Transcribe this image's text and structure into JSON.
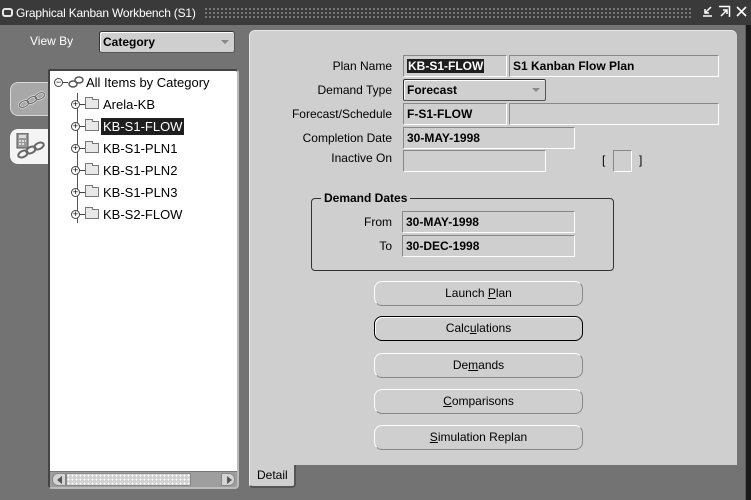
{
  "window": {
    "title": "Graphical Kanban Workbench (S1)",
    "controls": [
      "minimize-icon",
      "maximize-icon",
      "close-icon"
    ]
  },
  "view_by": {
    "label": "View By",
    "value": "Category"
  },
  "side_tabs": [
    {
      "name": "kanban-chain-icon",
      "active": false
    },
    {
      "name": "calculator-chain-icon",
      "active": true
    }
  ],
  "tree": {
    "root": "All Items by Category",
    "items": [
      {
        "label": "Arela-KB",
        "selected": false
      },
      {
        "label": "KB-S1-FLOW",
        "selected": true
      },
      {
        "label": "KB-S1-PLN1",
        "selected": false
      },
      {
        "label": "KB-S1-PLN2",
        "selected": false
      },
      {
        "label": "KB-S1-PLN3",
        "selected": false
      },
      {
        "label": "KB-S2-FLOW",
        "selected": false
      }
    ]
  },
  "detail": {
    "plan_name_label": "Plan Name",
    "plan_name": "KB-S1-FLOW",
    "plan_description": "S1 Kanban Flow Plan",
    "demand_type_label": "Demand Type",
    "demand_type": "Forecast",
    "forecast_schedule_label": "Forecast/Schedule",
    "forecast_schedule": "F-S1-FLOW",
    "forecast_schedule_desc": "",
    "completion_date_label": "Completion Date",
    "completion_date": "30-MAY-1998",
    "inactive_on_label": "Inactive On",
    "inactive_on": "",
    "bracket_open": "[",
    "bracket_close": "]",
    "demand_dates": {
      "title": "Demand Dates",
      "from_label": "From",
      "from": "30-MAY-1998",
      "to_label": "To",
      "to": "30-DEC-1998"
    },
    "buttons": [
      {
        "pre": "Launch ",
        "u": "P",
        "post": "lan"
      },
      {
        "pre": "Calc",
        "u": "u",
        "post": "lations"
      },
      {
        "pre": "De",
        "u": "m",
        "post": "ands"
      },
      {
        "pre": "",
        "u": "C",
        "post": "omparisons"
      },
      {
        "pre": "",
        "u": "S",
        "post": "imulation Replan"
      }
    ],
    "tab_label": "Detail"
  }
}
